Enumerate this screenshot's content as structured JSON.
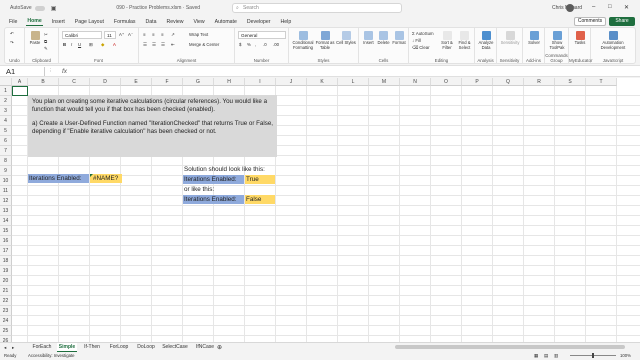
{
  "titlebar": {
    "autosave": "AutoSave",
    "doc": "090 - Practice Problems.xlsm  ·  Saved",
    "search": "Search",
    "user": "Chris Menard",
    "min": "–",
    "max": "□",
    "close": "✕"
  },
  "menu": [
    "File",
    "Home",
    "Insert",
    "Page Layout",
    "Formulas",
    "Data",
    "Review",
    "View",
    "Automate",
    "Developer",
    "Help"
  ],
  "menu_active": "Home",
  "buttons": {
    "comments": "Comments",
    "share": "Share"
  },
  "ribbon": {
    "groups": [
      "Undo",
      "Clipboard",
      "Font",
      "Alignment",
      "Number",
      "Styles",
      "Cells",
      "Editing",
      "Analysis",
      "Sensitivity",
      "Add-ins",
      "Commands Group",
      "MyEducator",
      "JavaScript"
    ],
    "paste": "Paste",
    "font_name": "Calibri",
    "font_size": "11",
    "number_format": "General",
    "wrap_text": "Wrap Text",
    "merge_center": "Merge & Center",
    "conditional": "Conditional Formatting",
    "format_table": "Format as Table",
    "cell_styles": "Cell Styles",
    "insert": "Insert",
    "delete": "Delete",
    "format": "Format",
    "autosum": "AutoSum",
    "fill": "Fill",
    "clear": "Clear",
    "sort_filter": "Sort & Filter",
    "find_select": "Find & Select",
    "analyze": "Analyze Data",
    "sensitivity": "Sensitivity",
    "solver": "Solver",
    "show_toolpak": "Show ToolPak",
    "tasks": "Tasks",
    "automation": "Automation Development"
  },
  "formula": {
    "namebox": "A1",
    "fx": "fx",
    "value": ""
  },
  "columns": [
    "A",
    "B",
    "C",
    "D",
    "E",
    "F",
    "G",
    "H",
    "I",
    "J",
    "K",
    "L",
    "M",
    "N",
    "O",
    "P",
    "Q",
    "R",
    "S",
    "T"
  ],
  "rows": [
    "1",
    "2",
    "3",
    "4",
    "5",
    "6",
    "7",
    "8",
    "9",
    "10",
    "11",
    "12",
    "13",
    "14",
    "15",
    "16",
    "17",
    "18",
    "19",
    "20",
    "21",
    "22",
    "23",
    "24",
    "25",
    "26"
  ],
  "content": {
    "intro": "You plan on creating some iterative calculations (circular references). You would like a function that would tell you if that box has been checked (enabled).",
    "task": "a) Create a User-Defined Function named \"IterationChecked\" that returns True or False, depending if \"Enable iterative calculation\" has been checked or not.",
    "iter_label": "Iterations Enabled:",
    "iter_value": "#NAME?",
    "solution_label": "Solution should look like this:",
    "sol_label1": "Iterations Enabled:",
    "sol_value1": "True",
    "or_like": "or like this:",
    "sol_label2": "Iterations Enabled:",
    "sol_value2": "False"
  },
  "tabs": [
    "ForEach",
    "Simple",
    "If-Then",
    "ForLoop",
    "DoLoop",
    "SelectCase",
    "IfNCase"
  ],
  "tab_active": "Simple",
  "status": {
    "ready": "Ready",
    "accessibility": "Accessibility: Investigate",
    "zoom": "100%"
  },
  "colors": {
    "accent": "#1e6e3e",
    "label_fill": "#8faadc",
    "value_fill": "#ffd966",
    "box_fill": "#d9d9d9"
  }
}
